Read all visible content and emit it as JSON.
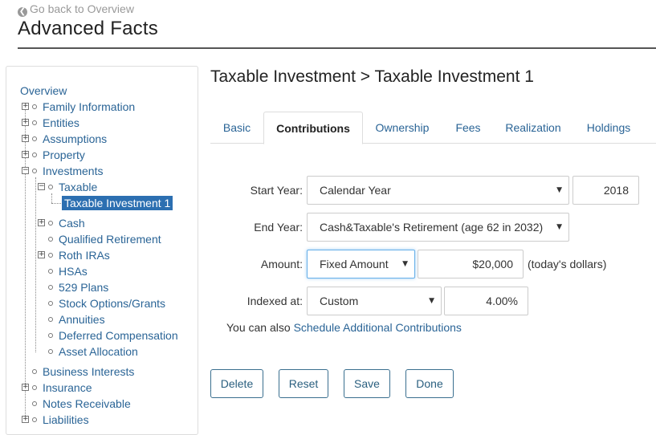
{
  "header": {
    "back_label": "Go back to Overview",
    "title": "Advanced Facts"
  },
  "tree": {
    "overview": "Overview",
    "family_information": "Family Information",
    "entities": "Entities",
    "assumptions": "Assumptions",
    "property": "Property",
    "investments": "Investments",
    "taxable": "Taxable",
    "taxable_investment_1": "Taxable Investment 1",
    "cash": "Cash",
    "qualified_retirement": "Qualified Retirement",
    "roth_iras": "Roth IRAs",
    "hsas": "HSAs",
    "plans_529": "529 Plans",
    "stock_options": "Stock Options/Grants",
    "annuities": "Annuities",
    "deferred_compensation": "Deferred Compensation",
    "asset_allocation": "Asset Allocation",
    "business_interests": "Business Interests",
    "insurance": "Insurance",
    "notes_receivable": "Notes Receivable",
    "liabilities": "Liabilities"
  },
  "main": {
    "heading": "Taxable Investment > Taxable Investment 1",
    "tabs": {
      "basic": "Basic",
      "contributions": "Contributions",
      "ownership": "Ownership",
      "fees": "Fees",
      "realization": "Realization",
      "holdings": "Holdings"
    }
  },
  "form": {
    "start_year": {
      "label": "Start Year:",
      "select": "Calendar Year",
      "value": "2018"
    },
    "end_year": {
      "label": "End Year:",
      "select": "Cash&Taxable's Retirement (age 62 in 2032)"
    },
    "amount": {
      "label": "Amount:",
      "select": "Fixed Amount",
      "value": "$20,000",
      "note": "(today's dollars)"
    },
    "indexed_at": {
      "label": "Indexed at:",
      "select": "Custom",
      "value": "4.00%"
    },
    "also_prefix": "You can also",
    "also_link": "Schedule Additional Contributions"
  },
  "buttons": {
    "delete": "Delete",
    "reset": "Reset",
    "save": "Save",
    "done": "Done"
  },
  "icons": {
    "back": "arrow-left-circle-icon",
    "expand": "plus-box-icon",
    "collapse": "minus-box-icon",
    "dropdown": "caret-down-icon"
  },
  "colors": {
    "link": "#2a6496",
    "selected_node": "#2c6fb1",
    "button_border": "#3a6f8f",
    "focus": "#66afe9"
  }
}
